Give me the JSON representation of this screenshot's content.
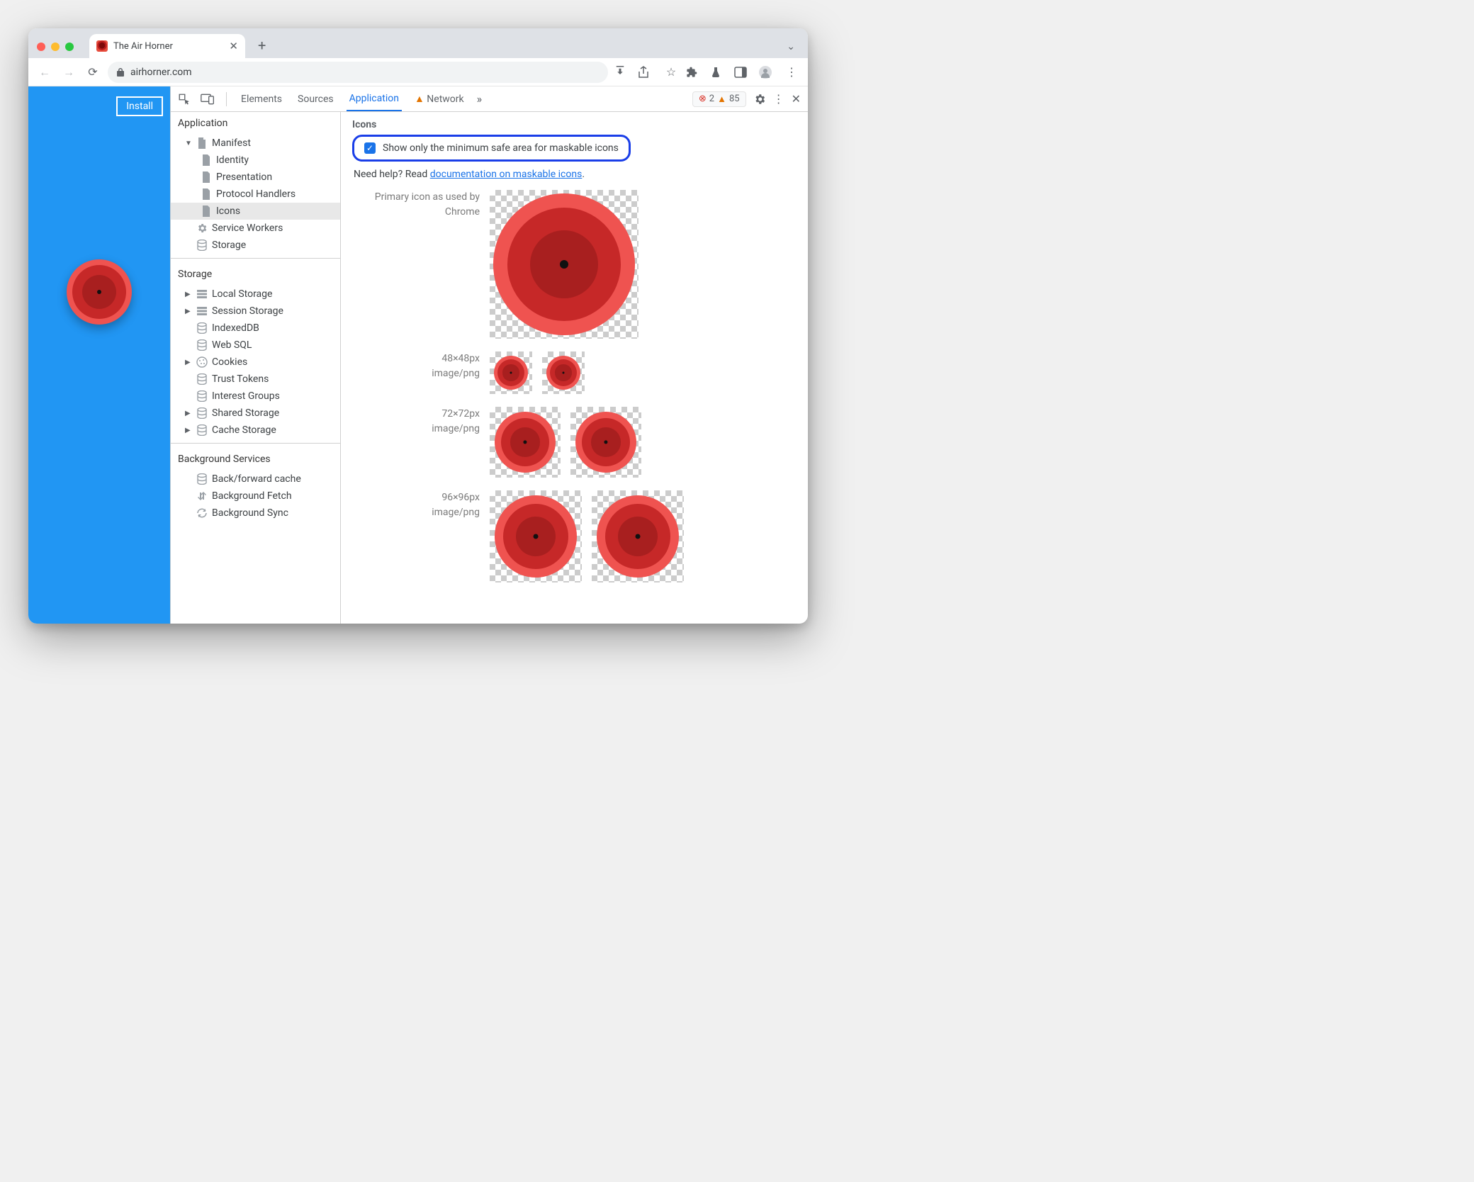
{
  "tabstrip": {
    "title": "The Air Horner"
  },
  "toolbar": {
    "url": "airhorner.com"
  },
  "page": {
    "install_label": "Install"
  },
  "devtools": {
    "tabs": {
      "elements": "Elements",
      "sources": "Sources",
      "application": "Application",
      "network": "Network"
    },
    "counts": {
      "errors": "2",
      "warnings": "85"
    }
  },
  "sidebar": {
    "application": {
      "title": "Application",
      "manifest": "Manifest",
      "identity": "Identity",
      "presentation": "Presentation",
      "protocol_handlers": "Protocol Handlers",
      "icons": "Icons",
      "service_workers": "Service Workers",
      "storage_node": "Storage"
    },
    "storage": {
      "title": "Storage",
      "local": "Local Storage",
      "session": "Session Storage",
      "indexeddb": "IndexedDB",
      "websql": "Web SQL",
      "cookies": "Cookies",
      "trusttokens": "Trust Tokens",
      "interestgroups": "Interest Groups",
      "sharedstorage": "Shared Storage",
      "cachestorage": "Cache Storage"
    },
    "bg": {
      "title": "Background Services",
      "bfcache": "Back/forward cache",
      "bgfetch": "Background Fetch",
      "bgsync": "Background Sync"
    }
  },
  "main": {
    "heading": "Icons",
    "checkbox_label": "Show only the minimum safe area for maskable icons",
    "help_prefix": "Need help? Read ",
    "help_link": "documentation on maskable icons",
    "help_suffix": ".",
    "primary_line1": "Primary icon as used by",
    "primary_line2": "Chrome",
    "rows": {
      "r48": {
        "size": "48×48px",
        "type": "image/png"
      },
      "r72": {
        "size": "72×72px",
        "type": "image/png"
      },
      "r96": {
        "size": "96×96px",
        "type": "image/png"
      }
    }
  }
}
